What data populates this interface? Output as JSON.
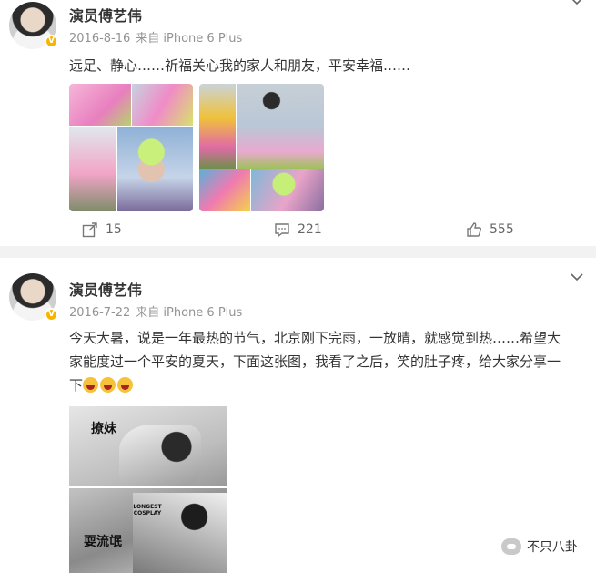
{
  "posts": [
    {
      "username": "演员傅艺伟",
      "date": "2016-8-16",
      "source": "来自 iPhone 6 Plus",
      "text": "远足、静心……祈福关心我的家人和朋友，平安幸福……",
      "actions": {
        "repost": "15",
        "comment": "221",
        "like": "555"
      }
    },
    {
      "username": "演员傅艺伟",
      "date": "2016-7-22",
      "source": "来自 iPhone 6 Plus",
      "text_line1": "今天大暑，说是一年最热的节气，北京刚下完雨，一放晴，就感觉到热……希望大",
      "text_line2": "家能度过一个平安的夏天，下面这张图，我看了之后，笑的肚子疼，给大家分享一",
      "text_line3": "下",
      "image_label_top": "撩妹",
      "image_label_bottom": "耍流氓",
      "image_logo": "LONGEST COSPLAY"
    }
  ],
  "icons": {
    "repost": "repost-icon",
    "comment": "comment-icon",
    "like": "like-icon",
    "menu": "chevron-down-icon",
    "verified": "verified-badge-icon",
    "emoji": "laugh-cry-emoji"
  },
  "watermark": "不只八卦",
  "colors": {
    "verified": "#f7b500",
    "meta": "#939393",
    "separator": "#f2f2f2"
  }
}
